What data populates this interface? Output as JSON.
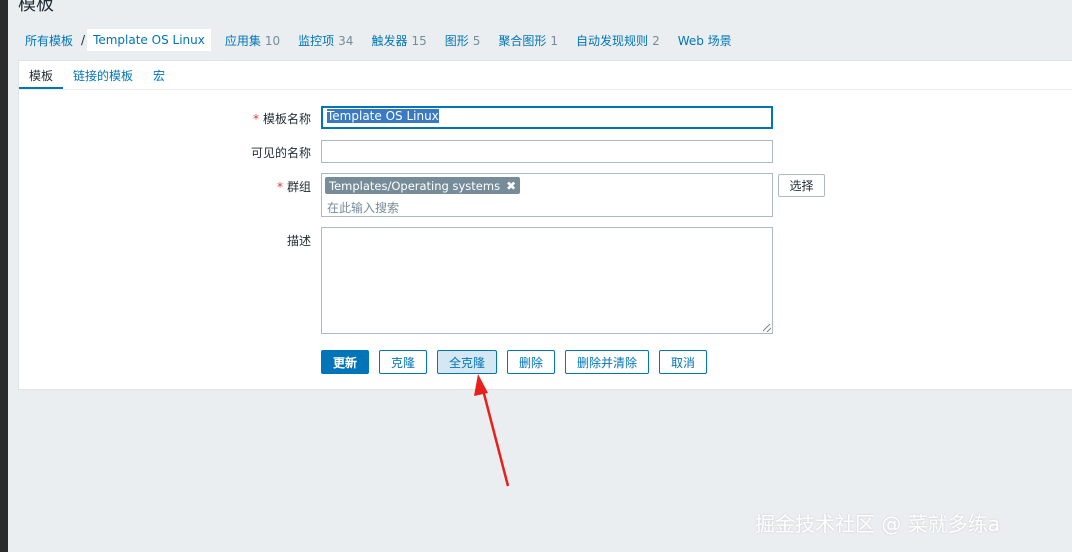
{
  "page_title": "模板",
  "breadcrumb": {
    "all_templates": "所有模板",
    "separator": "/",
    "current": "Template OS Linux"
  },
  "nav": [
    {
      "label": "应用集",
      "count": "10"
    },
    {
      "label": "监控项",
      "count": "34"
    },
    {
      "label": "触发器",
      "count": "15"
    },
    {
      "label": "图形",
      "count": "5"
    },
    {
      "label": "聚合图形",
      "count": "1"
    },
    {
      "label": "自动发现规则",
      "count": "2"
    },
    {
      "label": "Web 场景",
      "count": ""
    }
  ],
  "tabs": [
    "模板",
    "链接的模板",
    "宏"
  ],
  "form": {
    "template_name_label": "模板名称",
    "template_name_value": "Template OS Linux",
    "visible_name_label": "可见的名称",
    "visible_name_value": "",
    "groups_label": "群组",
    "group_chip": "Templates/Operating systems",
    "group_chip_remove": "✖",
    "groups_placeholder": "在此输入搜索",
    "select_button": "选择",
    "description_label": "描述",
    "description_value": "",
    "required_marker": "*"
  },
  "buttons": {
    "update": "更新",
    "clone": "克隆",
    "full_clone": "全克隆",
    "delete": "删除",
    "delete_and_clear": "删除并清除",
    "cancel": "取消"
  },
  "colors": {
    "accent": "#0275b8",
    "required": "#e33734",
    "annotation_arrow": "#e8201c"
  },
  "watermark": "掘金技术社区 @ 菜就多练a"
}
